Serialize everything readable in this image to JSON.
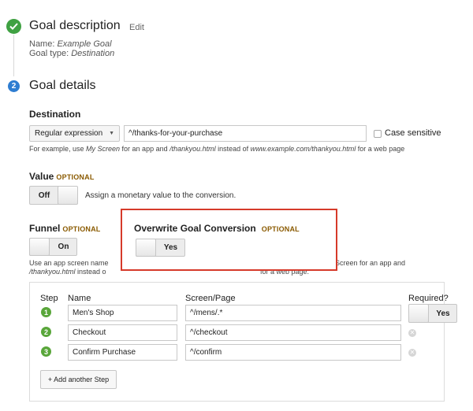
{
  "goal_description": {
    "title": "Goal description",
    "edit_label": "Edit",
    "name_label": "Name:",
    "name_value": "Example Goal",
    "type_label": "Goal type:",
    "type_value": "Destination"
  },
  "goal_details": {
    "step_number": "2",
    "title": "Goal details"
  },
  "destination": {
    "label": "Destination",
    "match_type": "Regular expression",
    "value": "^/thanks-for-your-purchase",
    "case_sensitive_label": "Case sensitive",
    "case_sensitive_checked": false,
    "hint_parts": [
      "For example, use ",
      "My Screen",
      " for an app and ",
      "/thankyou.html",
      " instead of ",
      "www.example.com/thankyou.html",
      " for a web page"
    ]
  },
  "value_section": {
    "label": "Value",
    "optional": "OPTIONAL",
    "toggle_state": "Off",
    "description": "Assign a monetary value to the conversion."
  },
  "funnel_section": {
    "label": "Funnel",
    "optional": "OPTIONAL",
    "toggle_state": "On",
    "hint_line1_start": "Use an app screen name",
    "hint_line1_end": "Screen for an app and",
    "hint_line2_start": "/thankyou.html",
    "hint_line2_mid": " instead o",
    "hint_line2_end": "for a web page."
  },
  "overwrite_section": {
    "label": "Overwrite Goal Conversion",
    "optional": "OPTIONAL",
    "toggle_state": "Yes"
  },
  "funnel_table": {
    "headers": {
      "step": "Step",
      "name": "Name",
      "screen": "Screen/Page",
      "required": "Required?"
    },
    "rows": [
      {
        "num": "1",
        "name": "Men's Shop",
        "screen": "^/mens/.*",
        "required": "Yes"
      },
      {
        "num": "2",
        "name": "Checkout",
        "screen": "^/checkout"
      },
      {
        "num": "3",
        "name": "Confirm Purchase",
        "screen": "^/confirm"
      }
    ],
    "add_step_label": "+ Add another Step"
  },
  "colors": {
    "done_green": "#3fa142",
    "step_blue": "#2e7dd1",
    "funnel_green": "#59a63a",
    "highlight_red": "#d63a2a",
    "optional_brown": "#8a5a00"
  },
  "icons": {
    "done": "checkmark-icon",
    "dropdown": "chevron-down-icon",
    "remove": "close-icon"
  }
}
